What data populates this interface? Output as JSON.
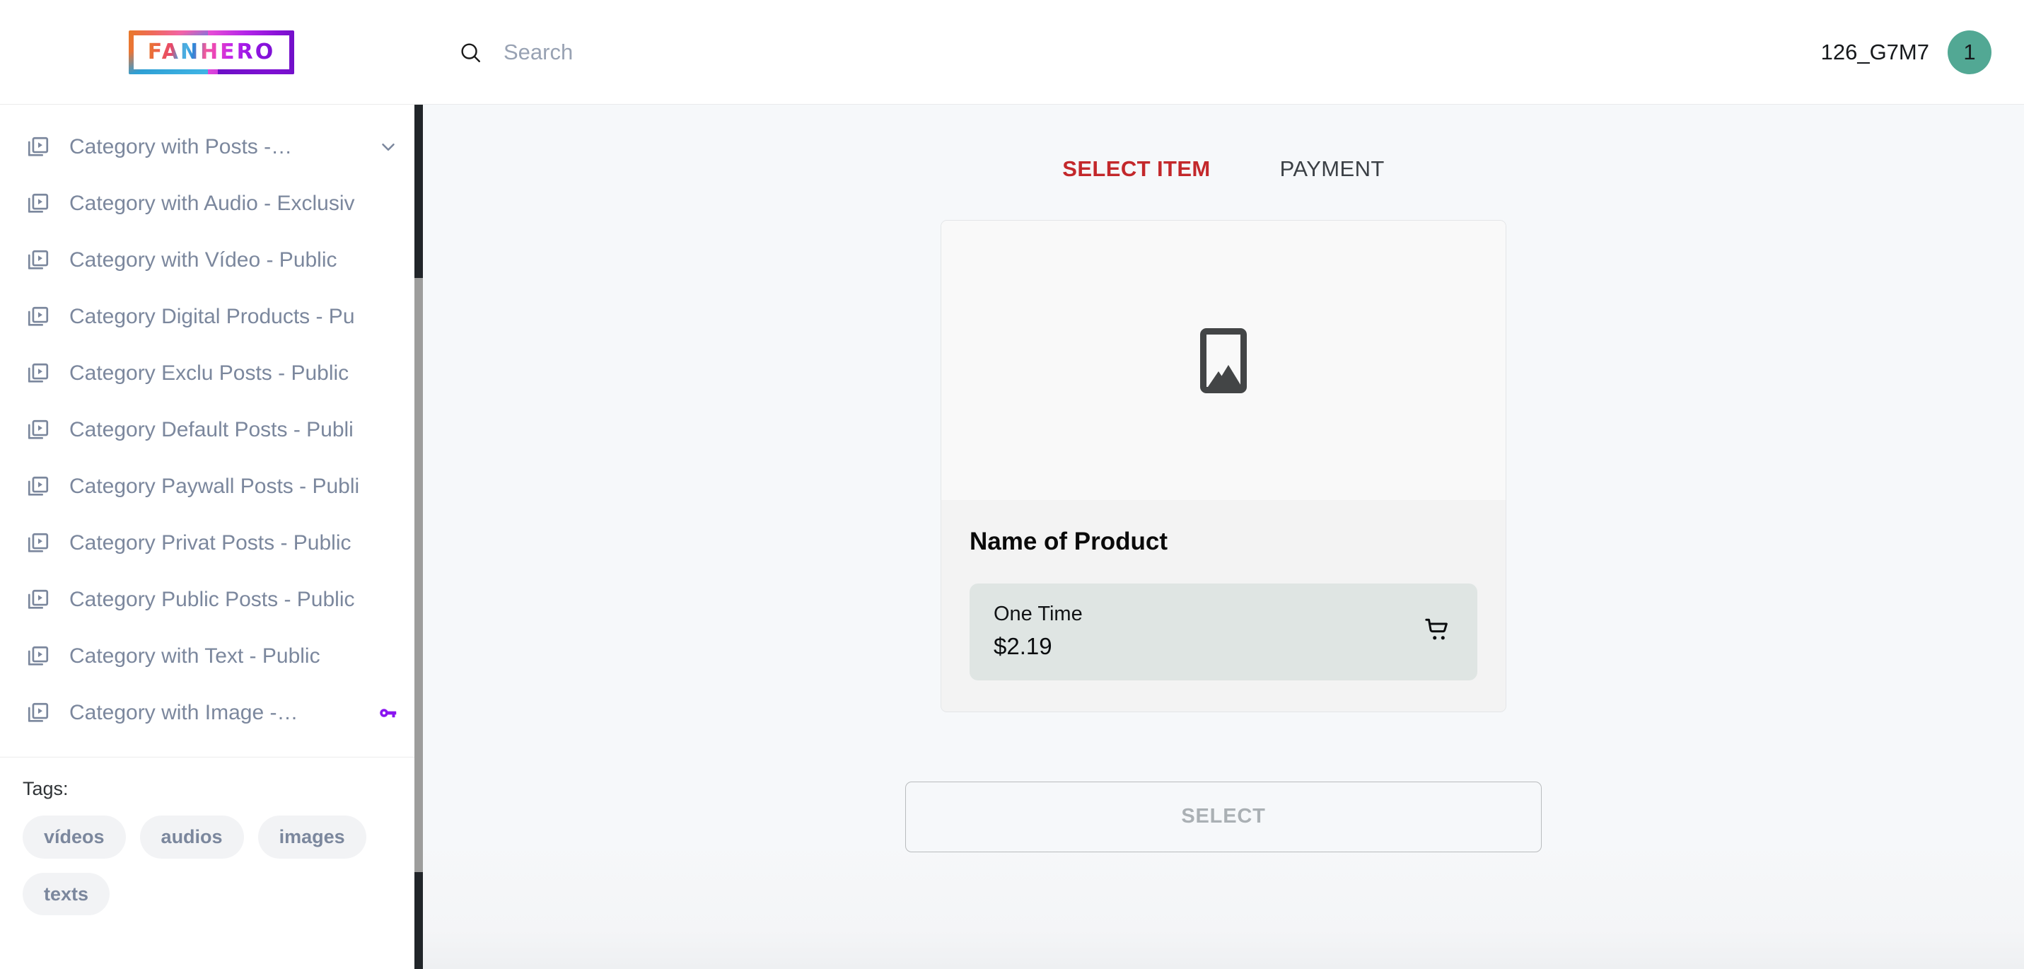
{
  "brand": {
    "logo_text": "FANHERO"
  },
  "sidebar": {
    "nav_items": [
      {
        "label": "Category with Posts -…",
        "icon": "video-library-icon",
        "trailing": "chevron-down-icon"
      },
      {
        "label": "Category with Audio - Exclusiv",
        "icon": "video-library-icon",
        "trailing": ""
      },
      {
        "label": "Category with Vídeo - Public",
        "icon": "video-library-icon",
        "trailing": ""
      },
      {
        "label": "Category Digital Products - Pu",
        "icon": "video-library-icon",
        "trailing": ""
      },
      {
        "label": "Category Exclu Posts - Public",
        "icon": "video-library-icon",
        "trailing": ""
      },
      {
        "label": "Category Default Posts - Publi",
        "icon": "video-library-icon",
        "trailing": ""
      },
      {
        "label": "Category Paywall Posts - Publi",
        "icon": "video-library-icon",
        "trailing": ""
      },
      {
        "label": "Category Privat Posts - Public",
        "icon": "video-library-icon",
        "trailing": ""
      },
      {
        "label": "Category Public Posts - Public",
        "icon": "video-library-icon",
        "trailing": ""
      },
      {
        "label": "Category with Text - Public",
        "icon": "video-library-icon",
        "trailing": ""
      },
      {
        "label": "Category with Image -…",
        "icon": "video-library-icon",
        "trailing": "key-icon"
      }
    ],
    "tags_title": "Tags:",
    "tags": [
      "vídeos",
      "audios",
      "images",
      "texts"
    ]
  },
  "topbar": {
    "search_placeholder": "Search",
    "search_value": "",
    "search_icon": "search-icon",
    "user_name": "126_G7M7",
    "avatar_initial": "1"
  },
  "checkout": {
    "tabs": [
      {
        "label": "SELECT ITEM",
        "active": true
      },
      {
        "label": "PAYMENT",
        "active": false
      }
    ],
    "product": {
      "image_placeholder_icon": "image-placeholder-icon",
      "name": "Name of Product",
      "price_label": "One Time",
      "price_value": "$2.19",
      "cart_icon": "shopping-cart-icon"
    },
    "select_button": "SELECT"
  },
  "colors": {
    "accent_red": "#c3282b",
    "avatar_green": "#52a894",
    "key_purple": "#8a16f0",
    "nav_text": "#7b879d",
    "price_box": "#dfe5e3",
    "page_bg": "#f6f8fa",
    "scrollbar_track": "#212529",
    "scrollbar_thumb": "#9d9d9c"
  }
}
